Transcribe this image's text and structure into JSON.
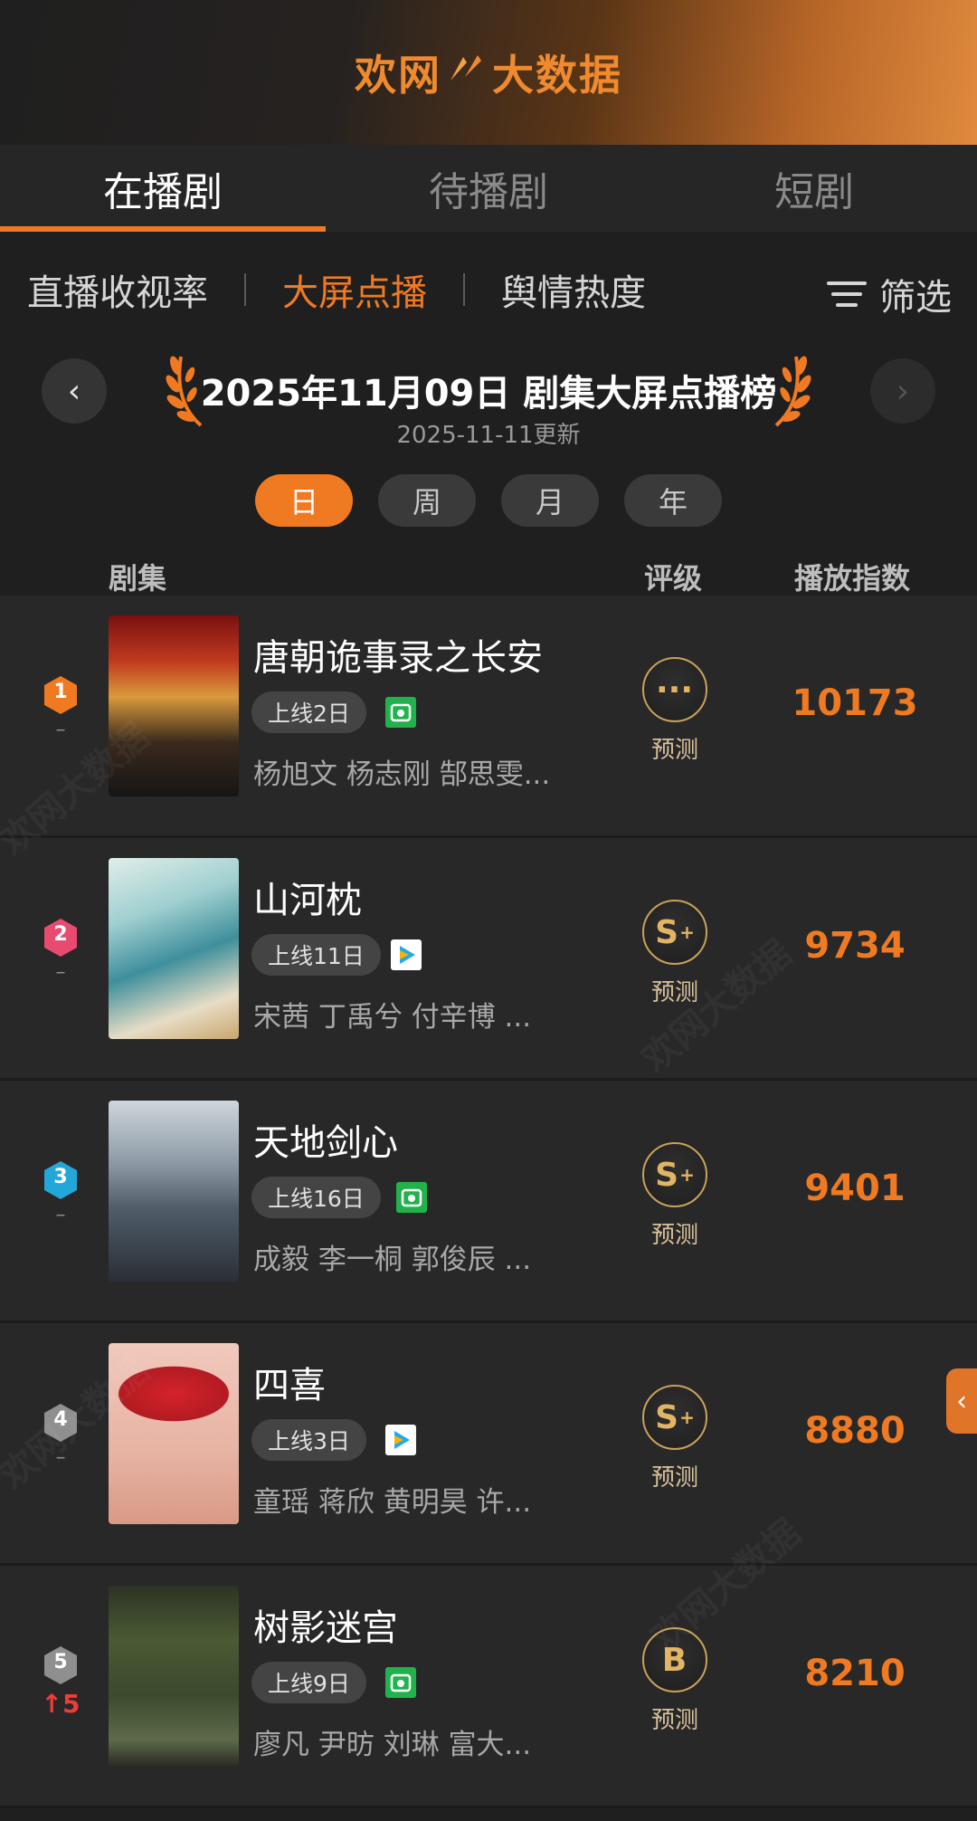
{
  "header": {
    "logo_text": "欢网",
    "logo_mark": "ᐟᐟ",
    "logo_text2": "大数据",
    "brand_color": "#f07a22"
  },
  "tabs": [
    {
      "label": "在播剧",
      "active": true
    },
    {
      "label": "待播剧",
      "active": false
    },
    {
      "label": "短剧",
      "active": false
    }
  ],
  "subnav": {
    "items": [
      {
        "label": "直播收视率",
        "active": false
      },
      {
        "label": "大屏点播",
        "active": true
      },
      {
        "label": "舆情热度",
        "active": false
      }
    ],
    "filter_label": "筛选"
  },
  "datebar": {
    "prev_icon": "‹",
    "next_icon": "›",
    "title": "2025年11月09日 剧集大屏点播榜",
    "updated": "2025-11-11更新"
  },
  "periods": [
    {
      "label": "日",
      "active": true
    },
    {
      "label": "周",
      "active": false
    },
    {
      "label": "月",
      "active": false
    },
    {
      "label": "年",
      "active": false
    }
  ],
  "columns": {
    "series": "剧集",
    "grade": "评级",
    "index": "播放指数"
  },
  "rows": [
    {
      "rank": "1",
      "rank_color": "#f07a22",
      "trend": "–",
      "title": "唐朝诡事录之长安",
      "days": "上线2日",
      "platform": "iqiyi-icon",
      "cast": "杨旭文 杨志刚 郜思雯...",
      "grade": "···",
      "grade_sup": "",
      "grade_label": "预测",
      "score": "10173"
    },
    {
      "rank": "2",
      "rank_color": "#e84a70",
      "trend": "–",
      "title": "山河枕",
      "days": "上线11日",
      "platform": "tencent-video-icon",
      "cast": "宋茜 丁禹兮 付辛博 ...",
      "grade": "S",
      "grade_sup": "+",
      "grade_label": "预测",
      "score": "9734"
    },
    {
      "rank": "3",
      "rank_color": "#22a7d8",
      "trend": "–",
      "title": "天地剑心",
      "days": "上线16日",
      "platform": "iqiyi-icon",
      "cast": "成毅 李一桐 郭俊辰 ...",
      "grade": "S",
      "grade_sup": "+",
      "grade_label": "预测",
      "score": "9401"
    },
    {
      "rank": "4",
      "rank_color": "#8f8f8f",
      "trend": "–",
      "title": "四喜",
      "days": "上线3日",
      "platform": "tencent-video-icon",
      "cast": "童瑶 蒋欣 黄明昊 许...",
      "grade": "S",
      "grade_sup": "+",
      "grade_label": "预测",
      "score": "8880"
    },
    {
      "rank": "5",
      "rank_color": "#8f8f8f",
      "trend": "↑5",
      "trend_up": true,
      "title": "树影迷宫",
      "days": "上线9日",
      "platform": "iqiyi-icon",
      "cast": "廖凡 尹昉 刘琳 富大...",
      "grade": "B",
      "grade_sup": "",
      "grade_label": "预测",
      "score": "8210"
    }
  ],
  "side_tab_icon": "‹",
  "watermark": "欢网大数据"
}
